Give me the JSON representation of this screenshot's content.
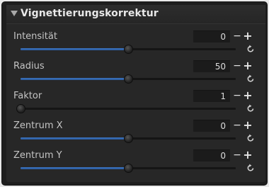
{
  "panel": {
    "title": "Vignettierungskorrektur",
    "collapse_icon": "triangle-down-icon"
  },
  "rows": [
    {
      "label": "Intensität",
      "value": "0",
      "slider_fraction": 0.5
    },
    {
      "label": "Radius",
      "value": "50",
      "slider_fraction": 0.5
    },
    {
      "label": "Faktor",
      "value": "1",
      "slider_fraction": 0.0
    },
    {
      "label": "Zentrum X",
      "value": "0",
      "slider_fraction": 0.5
    },
    {
      "label": "Zentrum Y",
      "value": "0",
      "slider_fraction": 0.5
    }
  ],
  "controls": {
    "decrement_symbol": "−",
    "increment_symbol": "+",
    "reset_icon": "reset-arrow-icon"
  },
  "colors": {
    "accent": "#3c74bf",
    "panel_bg": "#272727",
    "frame_bg": "#1e1e1e"
  }
}
